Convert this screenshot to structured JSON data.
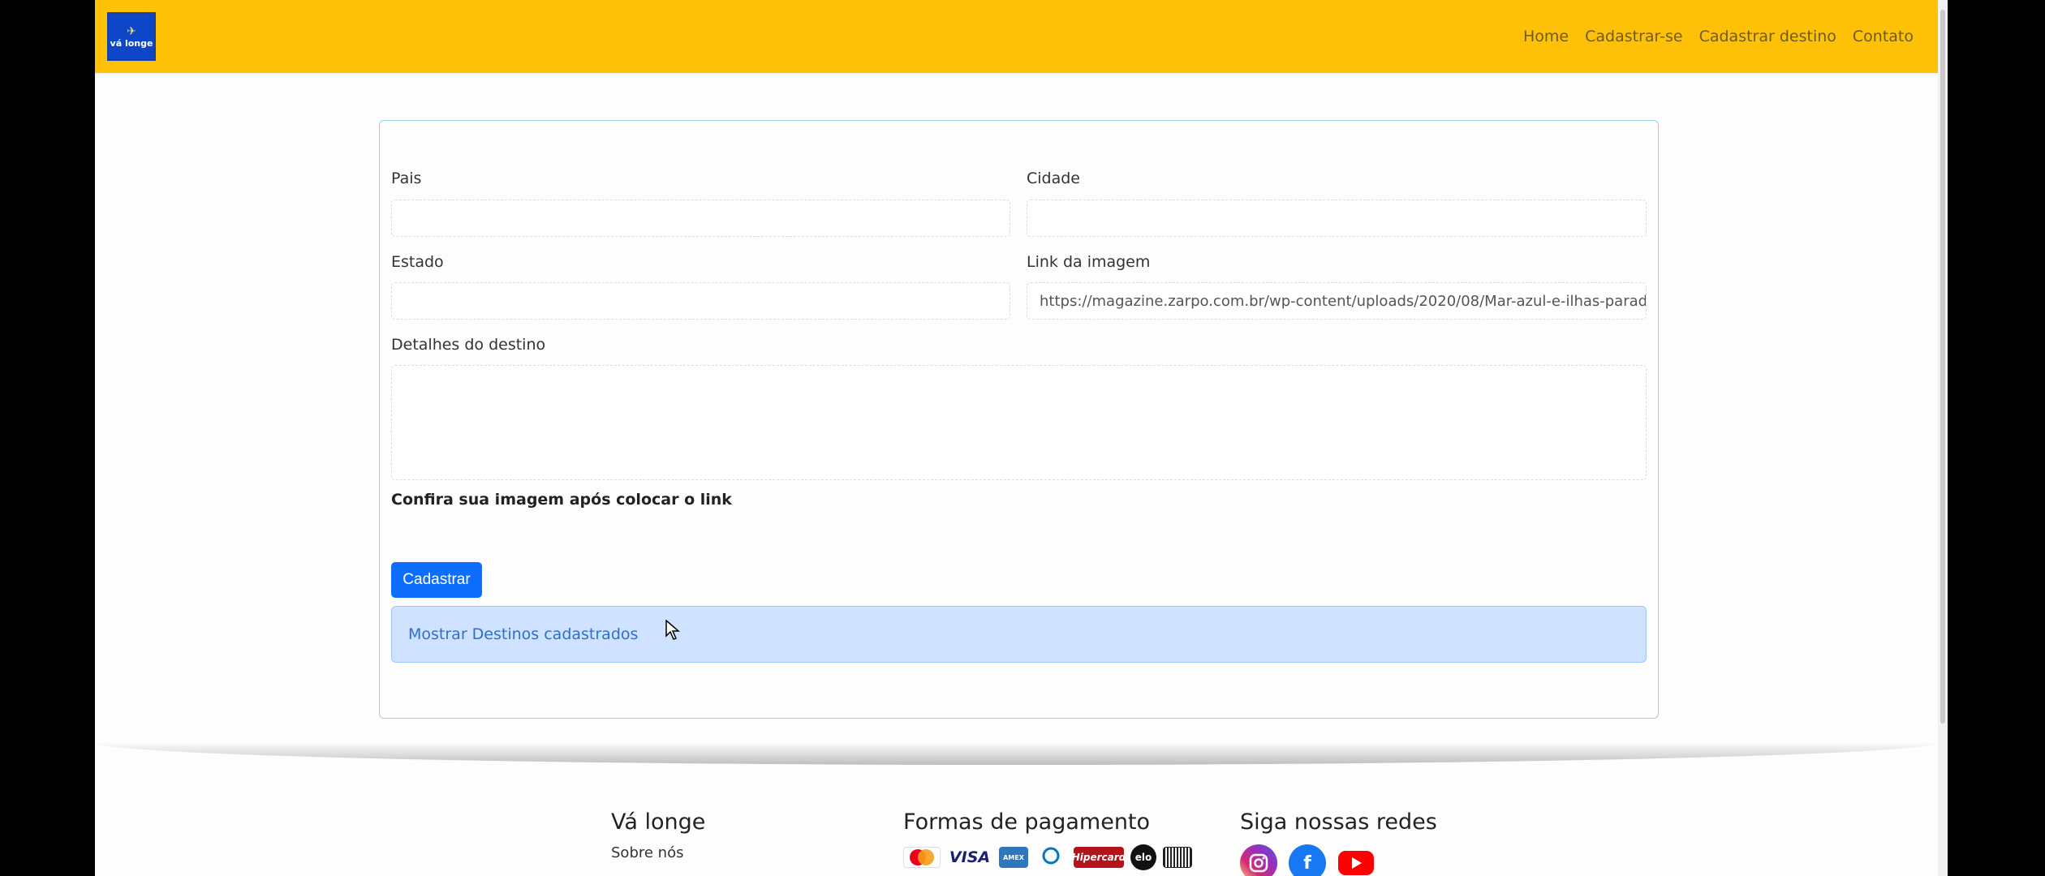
{
  "nav": {
    "logo_text": "vá longe",
    "links": [
      "Home",
      "Cadastrar-se",
      "Cadastrar destino",
      "Contato"
    ]
  },
  "form": {
    "pais_label": "Pais",
    "cidade_label": "Cidade",
    "estado_label": "Estado",
    "link_label": "Link da imagem",
    "link_value": "https://magazine.zarpo.com.br/wp-content/uploads/2020/08/Mar-azul-e-ilhas-paradis",
    "detalhes_label": "Detalhes do destino",
    "hint": "Confira sua imagem após colocar o link",
    "submit_label": "Cadastrar",
    "alert_link": "Mostrar Destinos cadastrados"
  },
  "footer": {
    "col1_title": "Vá longe",
    "col1_link": "Sobre nós",
    "col2_title": "Formas de pagamento",
    "col3_title": "Siga nossas redes",
    "payments": [
      "MasterCard",
      "VISA",
      "AMEX",
      "Diners Club",
      "Hipercard",
      "elo",
      "Boleto"
    ],
    "socials": [
      "instagram-icon",
      "facebook-icon",
      "youtube-icon"
    ]
  },
  "colors": {
    "navbar": "#ffc107",
    "primary": "#0d6efd",
    "alert_bg": "#cfe2ff"
  }
}
